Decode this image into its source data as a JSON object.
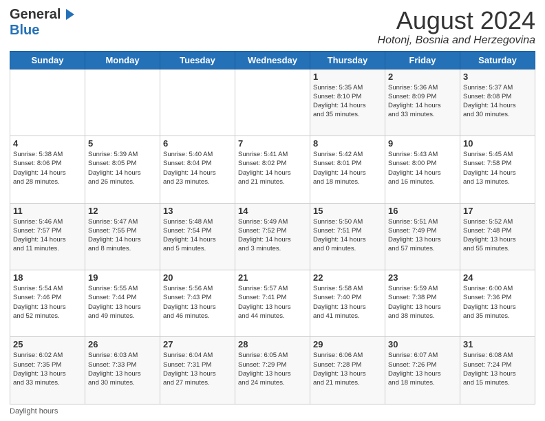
{
  "header": {
    "logo_line1": "General",
    "logo_line2": "Blue",
    "month_title": "August 2024",
    "location": "Hotonj, Bosnia and Herzegovina"
  },
  "days_of_week": [
    "Sunday",
    "Monday",
    "Tuesday",
    "Wednesday",
    "Thursday",
    "Friday",
    "Saturday"
  ],
  "weeks": [
    [
      {
        "day": "",
        "info": ""
      },
      {
        "day": "",
        "info": ""
      },
      {
        "day": "",
        "info": ""
      },
      {
        "day": "",
        "info": ""
      },
      {
        "day": "1",
        "info": "Sunrise: 5:35 AM\nSunset: 8:10 PM\nDaylight: 14 hours\nand 35 minutes."
      },
      {
        "day": "2",
        "info": "Sunrise: 5:36 AM\nSunset: 8:09 PM\nDaylight: 14 hours\nand 33 minutes."
      },
      {
        "day": "3",
        "info": "Sunrise: 5:37 AM\nSunset: 8:08 PM\nDaylight: 14 hours\nand 30 minutes."
      }
    ],
    [
      {
        "day": "4",
        "info": "Sunrise: 5:38 AM\nSunset: 8:06 PM\nDaylight: 14 hours\nand 28 minutes."
      },
      {
        "day": "5",
        "info": "Sunrise: 5:39 AM\nSunset: 8:05 PM\nDaylight: 14 hours\nand 26 minutes."
      },
      {
        "day": "6",
        "info": "Sunrise: 5:40 AM\nSunset: 8:04 PM\nDaylight: 14 hours\nand 23 minutes."
      },
      {
        "day": "7",
        "info": "Sunrise: 5:41 AM\nSunset: 8:02 PM\nDaylight: 14 hours\nand 21 minutes."
      },
      {
        "day": "8",
        "info": "Sunrise: 5:42 AM\nSunset: 8:01 PM\nDaylight: 14 hours\nand 18 minutes."
      },
      {
        "day": "9",
        "info": "Sunrise: 5:43 AM\nSunset: 8:00 PM\nDaylight: 14 hours\nand 16 minutes."
      },
      {
        "day": "10",
        "info": "Sunrise: 5:45 AM\nSunset: 7:58 PM\nDaylight: 14 hours\nand 13 minutes."
      }
    ],
    [
      {
        "day": "11",
        "info": "Sunrise: 5:46 AM\nSunset: 7:57 PM\nDaylight: 14 hours\nand 11 minutes."
      },
      {
        "day": "12",
        "info": "Sunrise: 5:47 AM\nSunset: 7:55 PM\nDaylight: 14 hours\nand 8 minutes."
      },
      {
        "day": "13",
        "info": "Sunrise: 5:48 AM\nSunset: 7:54 PM\nDaylight: 14 hours\nand 5 minutes."
      },
      {
        "day": "14",
        "info": "Sunrise: 5:49 AM\nSunset: 7:52 PM\nDaylight: 14 hours\nand 3 minutes."
      },
      {
        "day": "15",
        "info": "Sunrise: 5:50 AM\nSunset: 7:51 PM\nDaylight: 14 hours\nand 0 minutes."
      },
      {
        "day": "16",
        "info": "Sunrise: 5:51 AM\nSunset: 7:49 PM\nDaylight: 13 hours\nand 57 minutes."
      },
      {
        "day": "17",
        "info": "Sunrise: 5:52 AM\nSunset: 7:48 PM\nDaylight: 13 hours\nand 55 minutes."
      }
    ],
    [
      {
        "day": "18",
        "info": "Sunrise: 5:54 AM\nSunset: 7:46 PM\nDaylight: 13 hours\nand 52 minutes."
      },
      {
        "day": "19",
        "info": "Sunrise: 5:55 AM\nSunset: 7:44 PM\nDaylight: 13 hours\nand 49 minutes."
      },
      {
        "day": "20",
        "info": "Sunrise: 5:56 AM\nSunset: 7:43 PM\nDaylight: 13 hours\nand 46 minutes."
      },
      {
        "day": "21",
        "info": "Sunrise: 5:57 AM\nSunset: 7:41 PM\nDaylight: 13 hours\nand 44 minutes."
      },
      {
        "day": "22",
        "info": "Sunrise: 5:58 AM\nSunset: 7:40 PM\nDaylight: 13 hours\nand 41 minutes."
      },
      {
        "day": "23",
        "info": "Sunrise: 5:59 AM\nSunset: 7:38 PM\nDaylight: 13 hours\nand 38 minutes."
      },
      {
        "day": "24",
        "info": "Sunrise: 6:00 AM\nSunset: 7:36 PM\nDaylight: 13 hours\nand 35 minutes."
      }
    ],
    [
      {
        "day": "25",
        "info": "Sunrise: 6:02 AM\nSunset: 7:35 PM\nDaylight: 13 hours\nand 33 minutes."
      },
      {
        "day": "26",
        "info": "Sunrise: 6:03 AM\nSunset: 7:33 PM\nDaylight: 13 hours\nand 30 minutes."
      },
      {
        "day": "27",
        "info": "Sunrise: 6:04 AM\nSunset: 7:31 PM\nDaylight: 13 hours\nand 27 minutes."
      },
      {
        "day": "28",
        "info": "Sunrise: 6:05 AM\nSunset: 7:29 PM\nDaylight: 13 hours\nand 24 minutes."
      },
      {
        "day": "29",
        "info": "Sunrise: 6:06 AM\nSunset: 7:28 PM\nDaylight: 13 hours\nand 21 minutes."
      },
      {
        "day": "30",
        "info": "Sunrise: 6:07 AM\nSunset: 7:26 PM\nDaylight: 13 hours\nand 18 minutes."
      },
      {
        "day": "31",
        "info": "Sunrise: 6:08 AM\nSunset: 7:24 PM\nDaylight: 13 hours\nand 15 minutes."
      }
    ]
  ],
  "footer": {
    "daylight_label": "Daylight hours"
  }
}
